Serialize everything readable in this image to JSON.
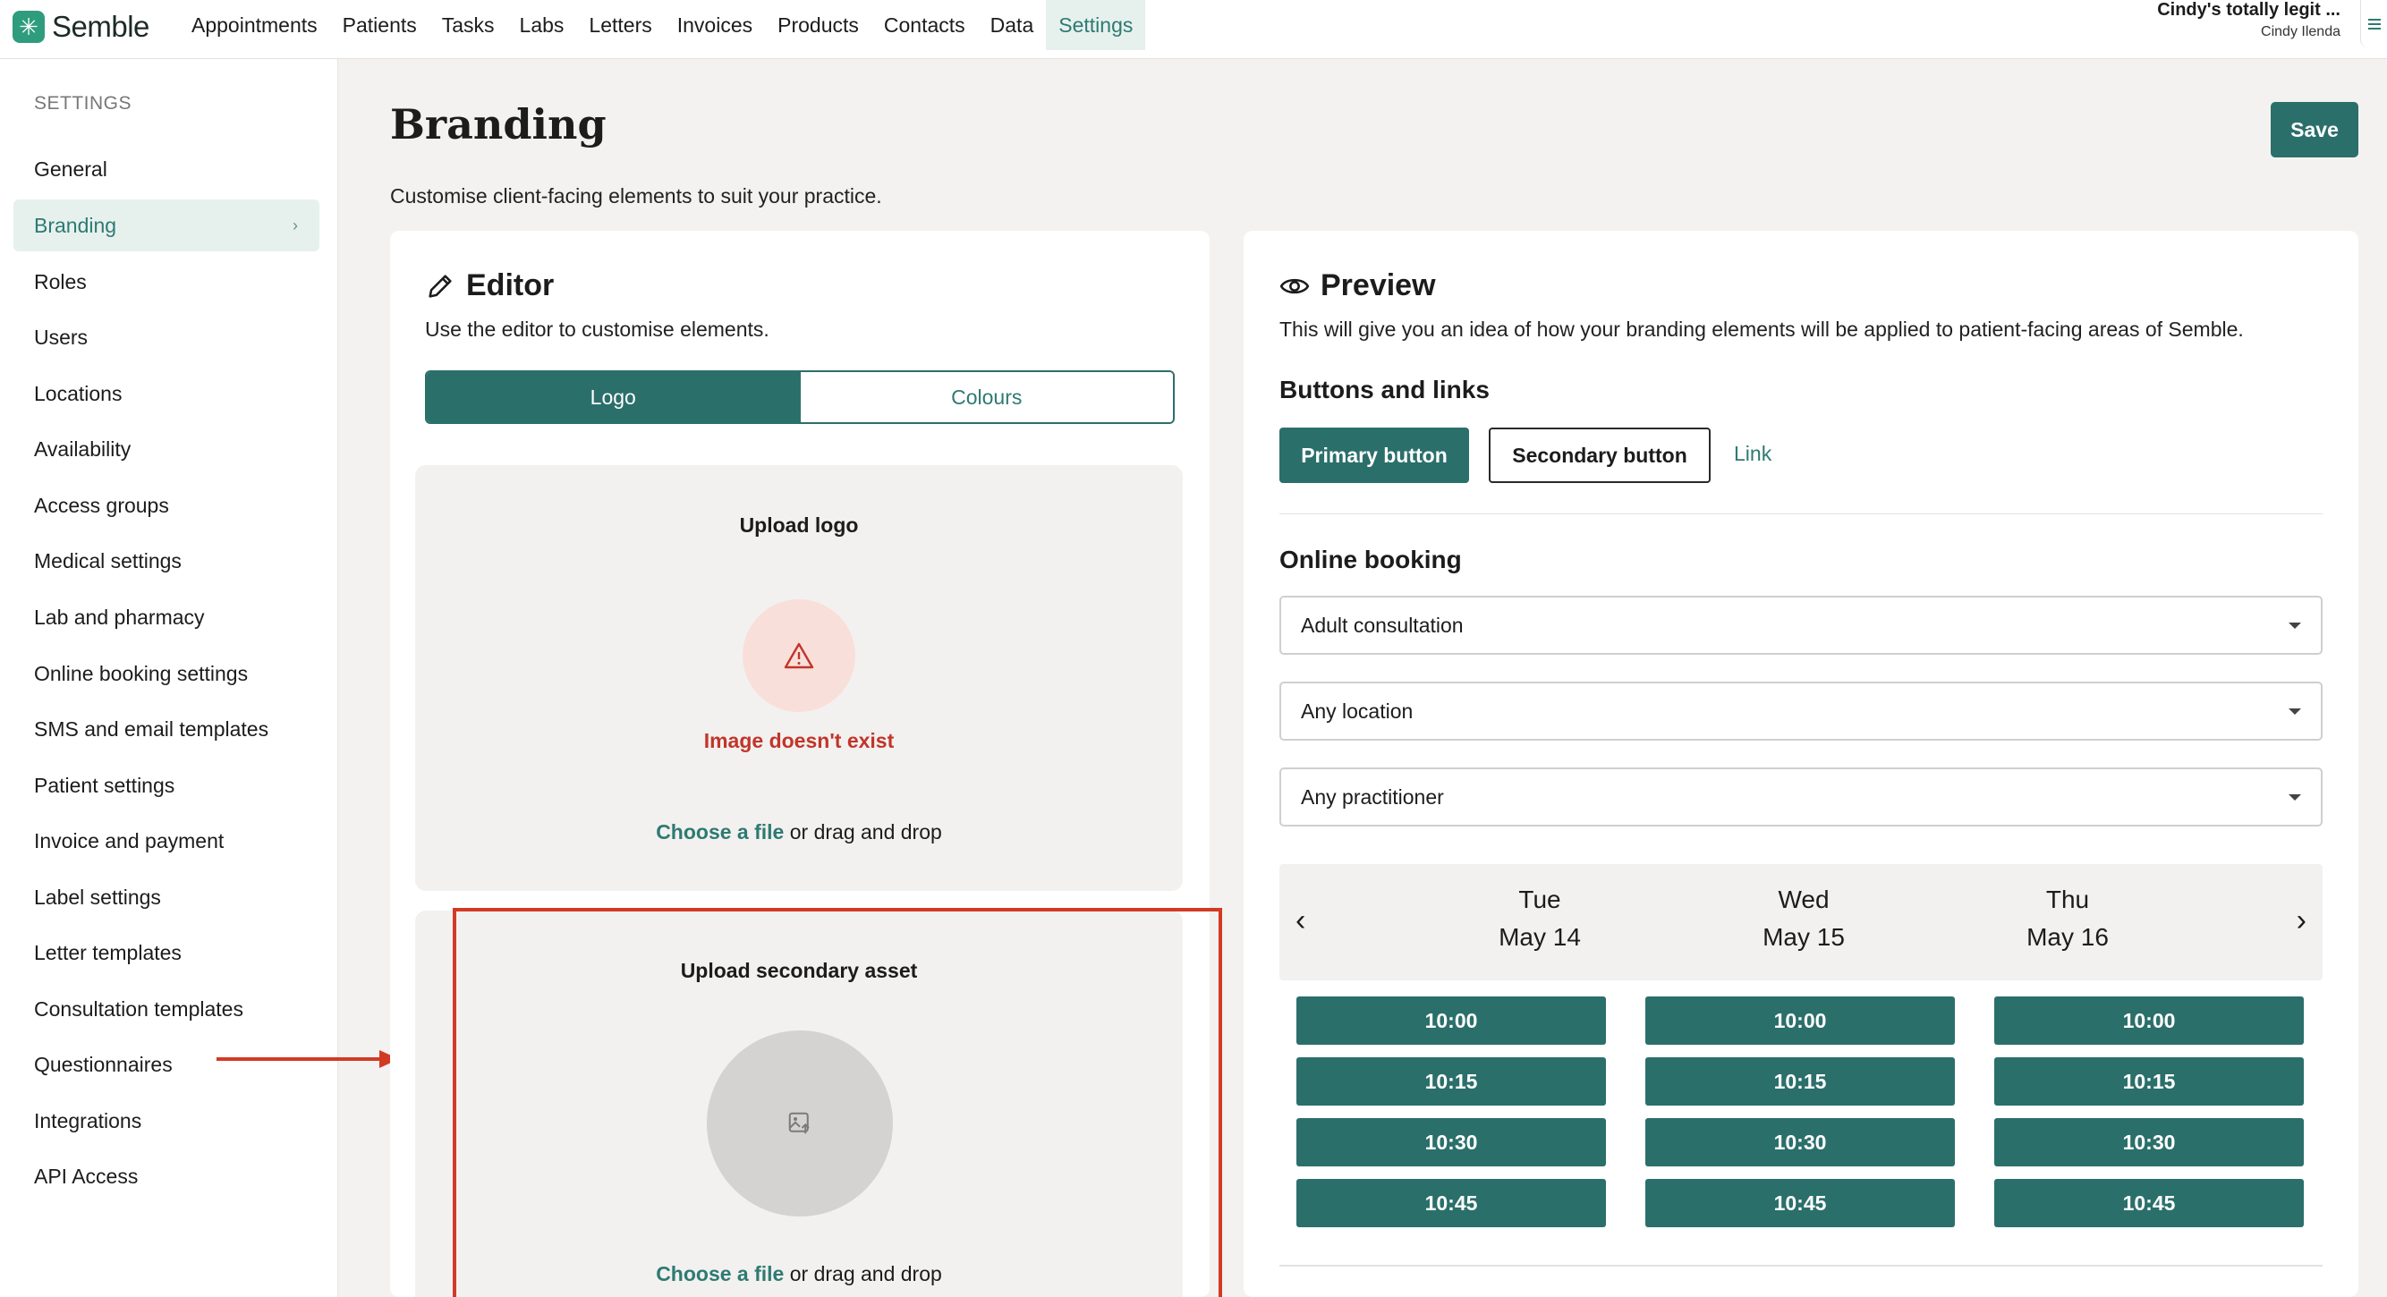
{
  "brand": {
    "name": "Semble",
    "logo_glyph": "✳",
    "accent": "#2b6f6b",
    "accent_light": "#e6f1ee",
    "error": "#c2352a",
    "highlight": "#d23a24"
  },
  "nav": {
    "links": [
      "Appointments",
      "Patients",
      "Tasks",
      "Labs",
      "Letters",
      "Invoices",
      "Products",
      "Contacts",
      "Data",
      "Settings"
    ],
    "active": "Settings"
  },
  "user": {
    "org": "Cindy's totally legit ...",
    "name": "Cindy Ilenda",
    "menu_icon": "menu-icon"
  },
  "sidebar": {
    "heading": "SETTINGS",
    "items": [
      "General",
      "Branding",
      "Roles",
      "Users",
      "Locations",
      "Availability",
      "Access groups",
      "Medical settings",
      "Lab and pharmacy",
      "Online booking settings",
      "SMS and email templates",
      "Patient settings",
      "Invoice and payment",
      "Label settings",
      "Letter templates",
      "Consultation templates",
      "Questionnaires",
      "Integrations",
      "API Access"
    ],
    "active": "Branding",
    "chevron": "›"
  },
  "page": {
    "title": "Branding",
    "subtitle": "Customise client-facing elements to suit your practice.",
    "save_label": "Save"
  },
  "editor": {
    "title": "Editor",
    "icon": "pencil-icon",
    "subtitle": "Use the editor to customise elements.",
    "tabs": [
      "Logo",
      "Colours"
    ],
    "active_tab": "Logo",
    "logo_upload": {
      "title": "Upload logo",
      "icon": "warning-icon",
      "error": "Image doesn't exist",
      "choose_link": "Choose a file",
      "choose_rest": " or drag and drop"
    },
    "secondary_upload": {
      "title": "Upload secondary asset",
      "icon": "image-upload-icon",
      "choose_link": "Choose a file",
      "choose_rest": " or drag and drop"
    }
  },
  "preview": {
    "title": "Preview",
    "icon": "eye-icon",
    "subtitle": "This will give you an idea of how your branding elements will be applied to patient-facing areas of Semble.",
    "buttons_heading": "Buttons and links",
    "primary_button": "Primary button",
    "secondary_button": "Secondary button",
    "link": "Link",
    "booking_heading": "Online booking",
    "selects": [
      "Adult consultation",
      "Any location",
      "Any practitioner"
    ],
    "prev_arrow": "‹",
    "next_arrow": "›",
    "days": [
      {
        "name": "Tue",
        "date": "May 14",
        "slots": [
          "10:00",
          "10:15",
          "10:30",
          "10:45"
        ]
      },
      {
        "name": "Wed",
        "date": "May 15",
        "slots": [
          "10:00",
          "10:15",
          "10:30",
          "10:45"
        ]
      },
      {
        "name": "Thu",
        "date": "May 16",
        "slots": [
          "10:00",
          "10:15",
          "10:30",
          "10:45"
        ]
      }
    ]
  }
}
